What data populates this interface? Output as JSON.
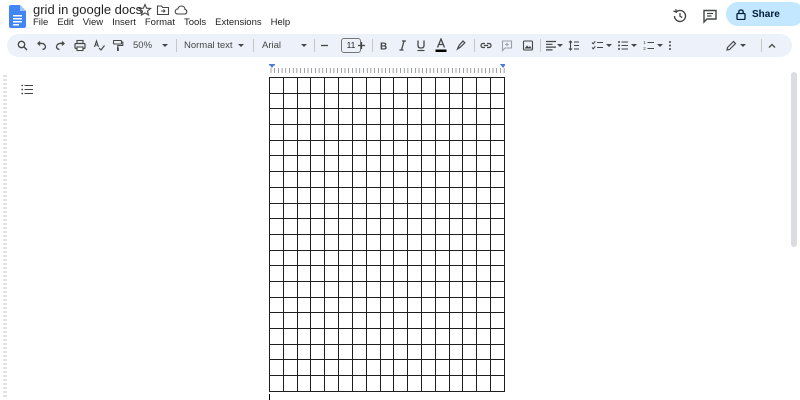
{
  "document": {
    "title": "grid in google docs"
  },
  "menubar": {
    "items": [
      "File",
      "Edit",
      "View",
      "Insert",
      "Format",
      "Tools",
      "Extensions",
      "Help"
    ]
  },
  "header": {
    "share_label": "Share"
  },
  "toolbar": {
    "zoom": "50%",
    "style": "Normal text",
    "font": "Arial",
    "font_size": "11"
  },
  "colors": {
    "accent": "#c2e7ff",
    "toolbar_bg": "#edf2fa",
    "grid_line": "#1f1f1f",
    "ruler_marker": "#4a7cd3"
  },
  "grid": {
    "rows": 20,
    "cols": 17
  },
  "icons": [
    "docs-logo-icon",
    "star-icon",
    "move-folder-icon",
    "cloud-status-icon",
    "history-icon",
    "comments-icon",
    "lock-icon",
    "search-icon",
    "undo-icon",
    "redo-icon",
    "print-icon",
    "spellcheck-icon",
    "paint-format-icon",
    "bold-icon",
    "italic-icon",
    "underline-icon",
    "text-color-icon",
    "highlight-icon",
    "link-icon",
    "add-comment-icon",
    "insert-image-icon",
    "align-icon",
    "line-spacing-icon",
    "checklist-icon",
    "bullet-list-icon",
    "numbered-list-icon",
    "more-icon",
    "editing-mode-icon",
    "collapse-icon",
    "outline-icon"
  ]
}
